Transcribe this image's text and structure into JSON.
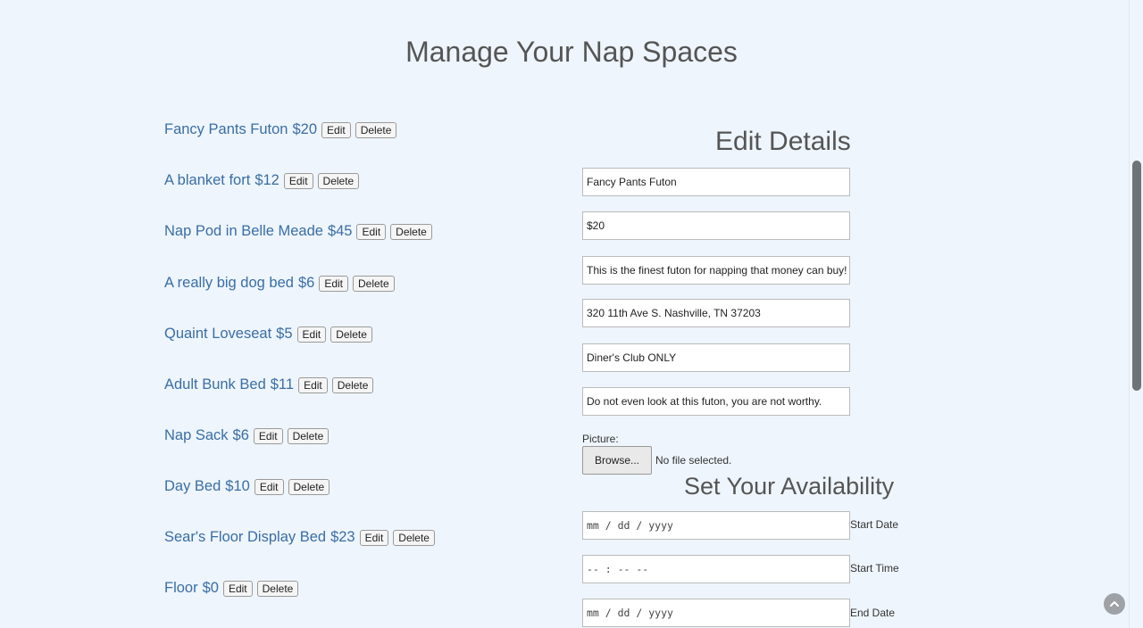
{
  "page_title": "Manage Your Nap Spaces",
  "listings": [
    {
      "name": "Fancy Pants Futon",
      "price": "$20",
      "edit_label": "Edit",
      "delete_label": "Delete"
    },
    {
      "name": "A blanket fort",
      "price": "$12",
      "edit_label": "Edit",
      "delete_label": "Delete"
    },
    {
      "name": "Nap Pod in Belle Meade",
      "price": "$45",
      "edit_label": "Edit",
      "delete_label": "Delete"
    },
    {
      "name": "A really big dog bed",
      "price": "$6",
      "edit_label": "Edit",
      "delete_label": "Delete"
    },
    {
      "name": "Quaint Loveseat",
      "price": "$5",
      "edit_label": "Edit",
      "delete_label": "Delete"
    },
    {
      "name": "Adult Bunk Bed",
      "price": "$11",
      "edit_label": "Edit",
      "delete_label": "Delete"
    },
    {
      "name": "Nap Sack",
      "price": "$6",
      "edit_label": "Edit",
      "delete_label": "Delete"
    },
    {
      "name": "Day Bed",
      "price": "$10",
      "edit_label": "Edit",
      "delete_label": "Delete"
    },
    {
      "name": "Sear's Floor Display Bed",
      "price": "$23",
      "edit_label": "Edit",
      "delete_label": "Delete"
    },
    {
      "name": "Floor",
      "price": "$0",
      "edit_label": "Edit",
      "delete_label": "Delete"
    }
  ],
  "edit_details": {
    "heading": "Edit Details",
    "name_value": "Fancy Pants Futon",
    "price_value": "$20",
    "description_value": "This is the finest futon for napping that money can buy!",
    "address_value": "320 11th Ave S. Nashville, TN 37203",
    "payment_value": "Diner's Club ONLY",
    "rules_value": "Do not even look at this futon, you are not worthy.",
    "picture_label": "Picture:",
    "browse_label": "Browse...",
    "file_status": "No file selected."
  },
  "availability": {
    "heading": "Set Your Availability",
    "start_date_placeholder": "mm / dd / yyyy",
    "start_date_label": "Start Date",
    "start_time_placeholder": "-- : --  --",
    "start_time_label": "Start Time",
    "end_date_placeholder": "mm / dd / yyyy",
    "end_date_label": "End Date"
  },
  "colors": {
    "background": "#eef5fc",
    "link": "#3a6ea5"
  },
  "icons": {
    "scroll_top": "chevron-up-icon"
  }
}
